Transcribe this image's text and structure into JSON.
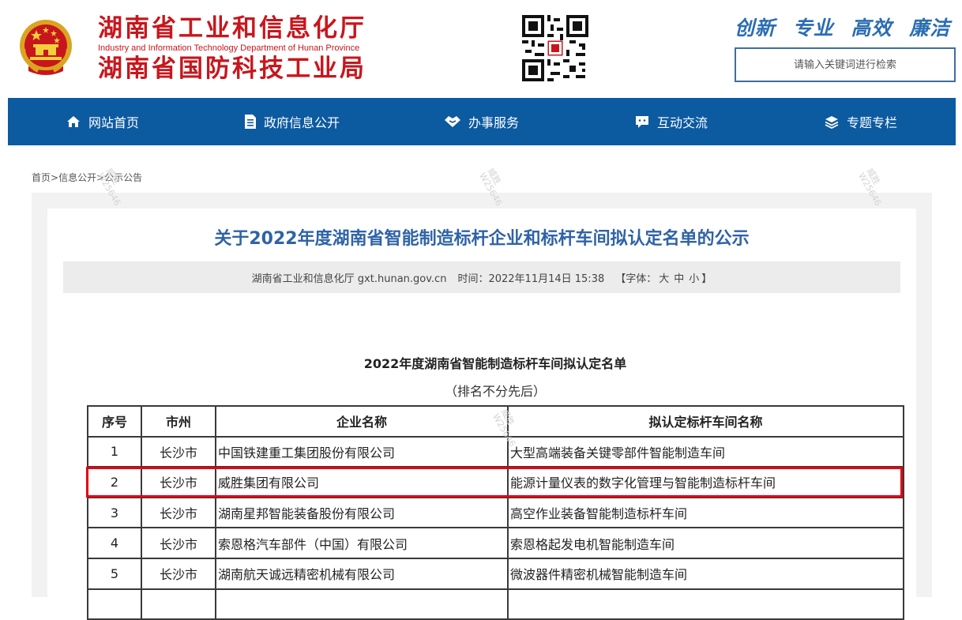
{
  "header": {
    "org_name_cn_1": "湖南省工业和信息化厅",
    "org_name_en": "Industry and Information Technology Department of Hunan Province",
    "org_name_cn_2": "湖南省国防科技工业局",
    "slogans": [
      "创新",
      "专业",
      "高效",
      "廉洁"
    ],
    "search_placeholder": "请输入关键词进行检索",
    "brand_color": "#c8161d",
    "slogan_color": "#2a6db3"
  },
  "nav": {
    "background": "#0c5aa0",
    "items": [
      {
        "label": "网站首页",
        "icon": "home-icon"
      },
      {
        "label": "政府信息公开",
        "icon": "document-icon"
      },
      {
        "label": "办事服务",
        "icon": "handshake-icon"
      },
      {
        "label": "互动交流",
        "icon": "chat-icon"
      },
      {
        "label": "专题专栏",
        "icon": "layers-icon"
      }
    ]
  },
  "breadcrumb": [
    "首页",
    "信息公开",
    "公示公告"
  ],
  "article": {
    "title": "关于2022年度湖南省智能制造标杆企业和标杆车间拟认定名单的公示",
    "source": "湖南省工业和信息化厅 gxt.hunan.gov.cn",
    "time_label": "时间：",
    "time": "2022年11月14日 15:38",
    "font_prefix": "【字体：",
    "font_sizes": [
      "大",
      "中",
      "小"
    ],
    "font_suffix": "】",
    "title_color": "#2f63a6"
  },
  "list": {
    "title": "2022年度湖南省智能制造标杆车间拟认定名单",
    "subtitle": "（排名不分先后）",
    "headers": [
      "序号",
      "市州",
      "企业名称",
      "拟认定标杆车间名称"
    ],
    "rows": [
      [
        "1",
        "长沙市",
        "中国铁建重工集团股份有限公司",
        "大型高端装备关键零部件智能制造车间"
      ],
      [
        "2",
        "长沙市",
        "威胜集团有限公司",
        "能源计量仪表的数字化管理与智能制造标杆车间"
      ],
      [
        "3",
        "长沙市",
        "湖南星邦智能装备股份有限公司",
        "高空作业装备智能制造标杆车间"
      ],
      [
        "4",
        "长沙市",
        "索恩格汽车部件（中国）有限公司",
        "索恩格起发电机智能制造车间"
      ],
      [
        "5",
        "长沙市",
        "湖南航天诚远精密机械有限公司",
        "微波器件精密机械智能制造车间"
      ],
      [
        "",
        "",
        "",
        ""
      ]
    ],
    "highlight_color": "#e60012"
  },
  "watermark": {
    "text_1": "威胜",
    "text_2": "W25646"
  }
}
